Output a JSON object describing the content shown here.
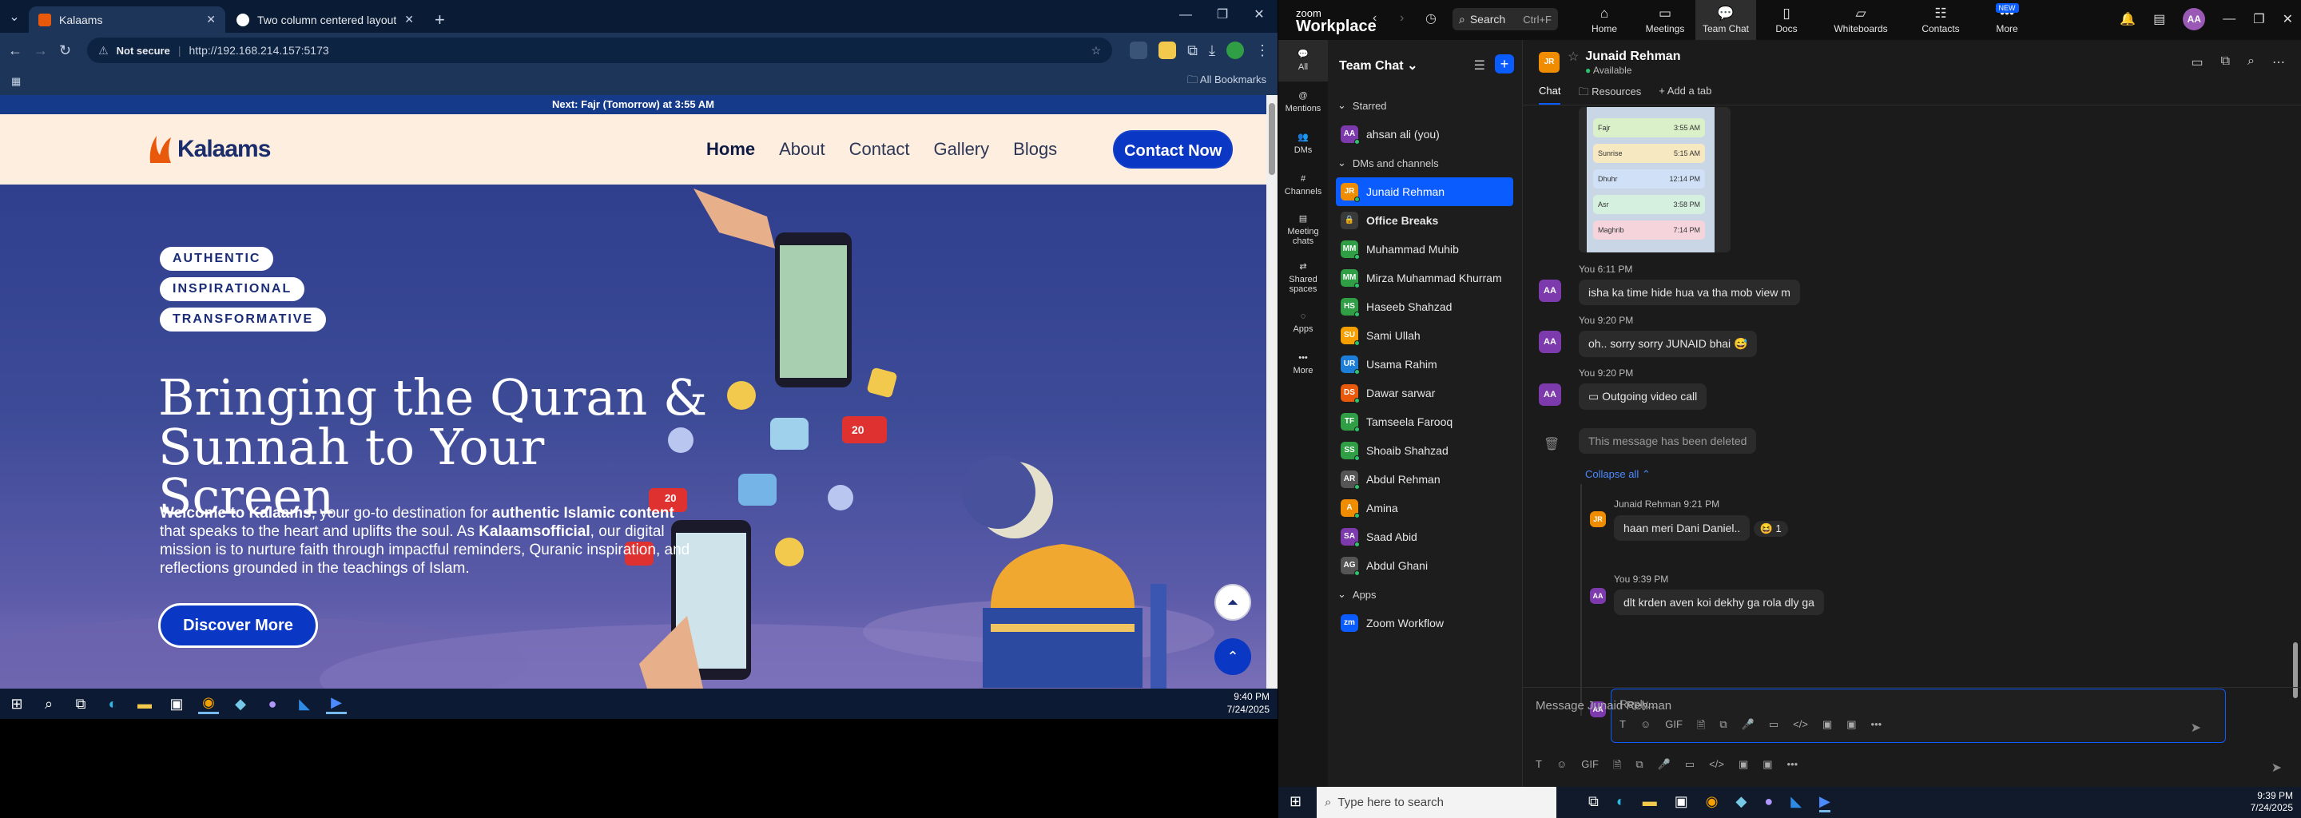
{
  "chrome": {
    "tabs": [
      {
        "title": "Kalaams",
        "active": true
      },
      {
        "title": "Two column centered layout",
        "active": false
      }
    ],
    "address": {
      "security": "Not secure",
      "url": "http://192.168.214.157:5173"
    },
    "all_bookmarks": "All Bookmarks"
  },
  "site": {
    "prayer_banner_prefix": "Next: ",
    "prayer_banner_bold": "Fajr (Tomorrow)",
    "prayer_banner_suffix": " at 3:55 AM",
    "logo_text": "Kalaams",
    "nav": [
      "Home",
      "About",
      "Contact",
      "Gallery",
      "Blogs"
    ],
    "contact_btn": "Contact Now",
    "pills": [
      "AUTHENTIC",
      "INSPIRATIONAL",
      "TRANSFORMATIVE"
    ],
    "headline": "Bringing the Quran & Sunnah to Your Screen",
    "lead_p1": "Welcome to Kalaams",
    "lead_p2": ", your go-to destination for ",
    "lead_p3": "authentic Islamic content",
    "lead_p4": " that speaks to the heart and uplifts the soul. As ",
    "lead_p5": "Kalaamsofficial",
    "lead_p6": ", our digital mission is to nurture faith through impactful reminders, Quranic inspiration, and reflections grounded in the teachings of Islam.",
    "discover_btn": "Discover More",
    "like_count": "20",
    "heart_count": "20"
  },
  "left_taskbar": {
    "time": "9:40 PM",
    "date": "7/24/2025"
  },
  "zoom": {
    "brand": "zoom",
    "brand_sub": "Workplace",
    "search": "Search",
    "search_kbd": "Ctrl+F",
    "nav": [
      {
        "label": "Home",
        "icon": "home-icon"
      },
      {
        "label": "Meetings",
        "icon": "video-icon"
      },
      {
        "label": "Team Chat",
        "icon": "chat-icon"
      },
      {
        "label": "Docs",
        "icon": "doc-icon"
      },
      {
        "label": "Whiteboards",
        "icon": "whiteboard-icon"
      },
      {
        "label": "Contacts",
        "icon": "contacts-icon"
      },
      {
        "label": "More",
        "icon": "more-icon"
      }
    ],
    "new_badge": "NEW",
    "user_initials": "AA",
    "rail": [
      "All",
      "Mentions",
      "DMs",
      "Channels",
      "Meeting chats",
      "Shared spaces",
      "Apps",
      "More"
    ],
    "panel_title": "Team Chat",
    "starred_label": "Starred",
    "dms_label": "DMs and channels",
    "apps_label": "Apps",
    "starred": [
      {
        "name": "ahsan ali (you)",
        "ini": "AA",
        "color": "#7c3aad"
      }
    ],
    "dms": [
      {
        "name": "Junaid Rehman",
        "ini": "JR",
        "color": "#f08c00",
        "sel": true
      },
      {
        "name": "Office Breaks",
        "ini": "🔒",
        "color": "#3a3a3a",
        "bold": true
      },
      {
        "name": "Muhammad Muhib",
        "ini": "MM",
        "color": "#2f9e44"
      },
      {
        "name": "Mirza Muhammad Khurram",
        "ini": "MM",
        "color": "#2f9e44"
      },
      {
        "name": "Haseeb Shahzad",
        "ini": "HS",
        "color": "#2f9e44"
      },
      {
        "name": "Sami Ullah",
        "ini": "SU",
        "color": "#f59f00"
      },
      {
        "name": "Usama Rahim",
        "ini": "UR",
        "color": "#1c7ed6"
      },
      {
        "name": "Dawar sarwar",
        "ini": "DS",
        "color": "#e8590c"
      },
      {
        "name": "Tamseela Farooq",
        "ini": "TF",
        "color": "#2f9e44"
      },
      {
        "name": "Shoaib Shahzad",
        "ini": "SS",
        "color": "#2f9e44"
      },
      {
        "name": "Abdul Rehman",
        "ini": "AR",
        "color": "#555"
      },
      {
        "name": "Amina",
        "ini": "A",
        "color": "#f08c00"
      },
      {
        "name": "Saad Abid",
        "ini": "SA",
        "color": "#7c3aad"
      },
      {
        "name": "Abdul Ghani",
        "ini": "AG",
        "color": "#555"
      }
    ],
    "apps": [
      {
        "name": "Zoom Workflow",
        "ini": "zm",
        "color": "#0b5cff"
      }
    ],
    "chat": {
      "name": "Junaid Rehman",
      "status": "Available",
      "ini": "JR",
      "tabs": [
        "Chat",
        "Resources",
        "Add a tab"
      ],
      "prayer_times": [
        [
          "Fajr",
          "3:55 AM"
        ],
        [
          "Sunrise",
          "5:15 AM"
        ],
        [
          "Dhuhr",
          "12:14 PM"
        ],
        [
          "Asr",
          "3:58 PM"
        ],
        [
          "Maghrib",
          "7:14 PM"
        ]
      ],
      "messages": [
        {
          "time": "You 6:11 PM",
          "text": "isha ka time hide hua va tha mob view m"
        },
        {
          "time": "You 9:20 PM",
          "text": "oh.. sorry sorry JUNAID bhai 😅"
        },
        {
          "time": "You 9:20 PM",
          "text": "Outgoing video call"
        }
      ],
      "deleted": "This message has been deleted",
      "collapse": "Collapse all",
      "replies": [
        {
          "time": "Junaid Rehman 9:21 PM",
          "text": "haan meri Dani Daniel..",
          "reaction": "😆 1"
        },
        {
          "time": "You 9:39 PM",
          "text": "dlt krden aven koi dekhy ga rola dly ga"
        }
      ],
      "reply_placeholder": "Reply...",
      "message_placeholder": "Message Junaid Rehman",
      "tools": [
        "T",
        "☺",
        "GIF",
        "🗎",
        "⧉",
        "🎤",
        "▭",
        "</>",
        "▣",
        "▣",
        "•••"
      ]
    }
  },
  "right_taskbar": {
    "search": "Type here to search",
    "time": "9:39 PM",
    "date": "7/24/2025"
  }
}
